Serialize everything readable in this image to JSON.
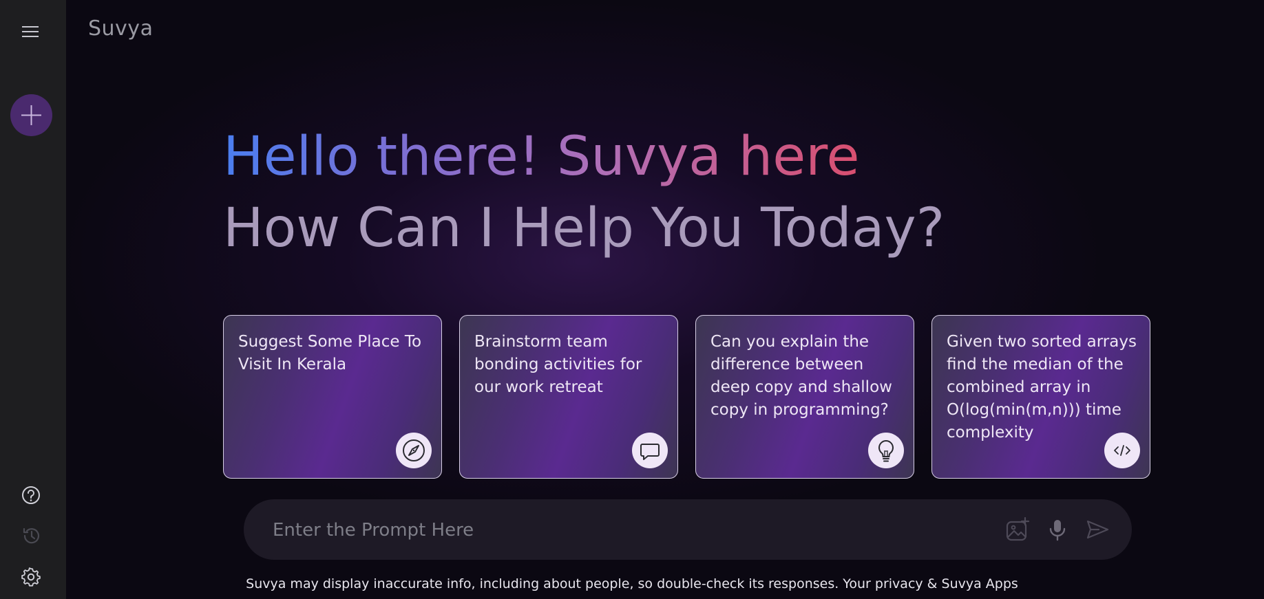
{
  "app": {
    "brand": "Suvya"
  },
  "sidebar": {
    "menu_icon": "hamburger-menu-icon",
    "new_chat_icon": "plus-icon",
    "bottom_icons": [
      "help-icon",
      "history-icon",
      "settings-icon"
    ]
  },
  "hero": {
    "greeting": "Hello there! Suvya here",
    "subtitle": "How Can I Help You Today?"
  },
  "cards": [
    {
      "text": "Suggest Some Place To Visit In Kerala",
      "icon": "compass-icon"
    },
    {
      "text": "Brainstorm team bonding activities for our work retreat",
      "icon": "message-icon"
    },
    {
      "text": "Can you explain the difference between deep copy and shallow copy in programming?",
      "icon": "lightbulb-icon"
    },
    {
      "text": "Given two sorted arrays find the median of the combined array in O(log(min(m,n))) time complexity",
      "icon": "code-icon"
    }
  ],
  "prompt": {
    "placeholder": "Enter the Prompt Here",
    "value": "",
    "icons": [
      "image-upload-icon",
      "microphone-icon",
      "send-icon"
    ]
  },
  "footer": {
    "text": "Suvya may display inaccurate info, including about people, so double-check its responses. Your privacy & Suvya Apps"
  },
  "colors": {
    "sidebar_bg": "#1e1e20",
    "main_bg": "#0b0812",
    "accent_purple": "#4a2a6e",
    "gradient_start": "#4a7ef0",
    "gradient_end": "#d94f6f",
    "subtitle_color": "#a99bbb"
  }
}
